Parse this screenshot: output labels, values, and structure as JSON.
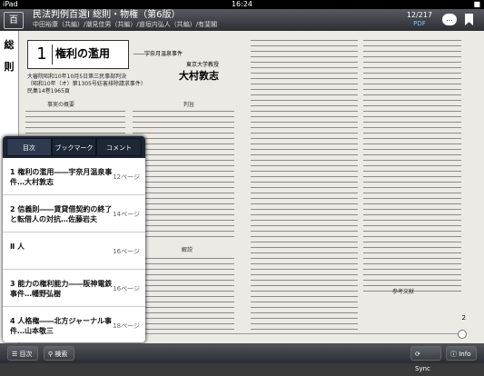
{
  "status": {
    "left": "iPad",
    "time": "16:24",
    "right": "■"
  },
  "title": {
    "logo": "百",
    "main": "民法判例百選Ⅰ 総則・物権（第6版）",
    "sub": "中田裕康（共編）/潮見佳男（共編）/道垣内弘人（共編）/有斐閣"
  },
  "pager": {
    "page": "12/217",
    "type": "PDF"
  },
  "buttons": {
    "comment_icon": "…"
  },
  "spine": {
    "text": [
      "総",
      "則"
    ]
  },
  "page": {
    "box_num": "1",
    "case_title": "権利の濫用",
    "case_sub": "――宇奈月温泉事件",
    "case_info": "大審院昭和10年10月5日第三民事部判決\n（昭和10年（オ）第1305号妨害排除請求事件）\n民集14巻1965頁",
    "author_label": "東京大学教授",
    "author": "大村敦志",
    "section1": "事実の概要",
    "section2": "判旨",
    "section3": "解説",
    "section4": "参考文献",
    "footnote": "2"
  },
  "toc": {
    "tabs": [
      "目次",
      "ブックマーク",
      "コメント"
    ],
    "items": [
      {
        "title": "1 権利の濫用――宇奈月温泉事件…大村敦志",
        "page": "12ページ"
      },
      {
        "title": "2 信義則――賃貸借契約の終了と転借人の対抗…佐藤岩夫",
        "page": "14ページ"
      },
      {
        "title": "Ⅱ 人",
        "page": "16ページ"
      },
      {
        "title": "3 能力の権利能力――阪神電鉄事件…幡野弘樹",
        "page": "16ページ"
      },
      {
        "title": "4 人格権――北方ジャーナル事件…山本敬三",
        "page": "18ページ"
      }
    ]
  },
  "toolbar": {
    "toc": "目次",
    "search": "検索",
    "sync": "Sync",
    "info": "Info"
  }
}
